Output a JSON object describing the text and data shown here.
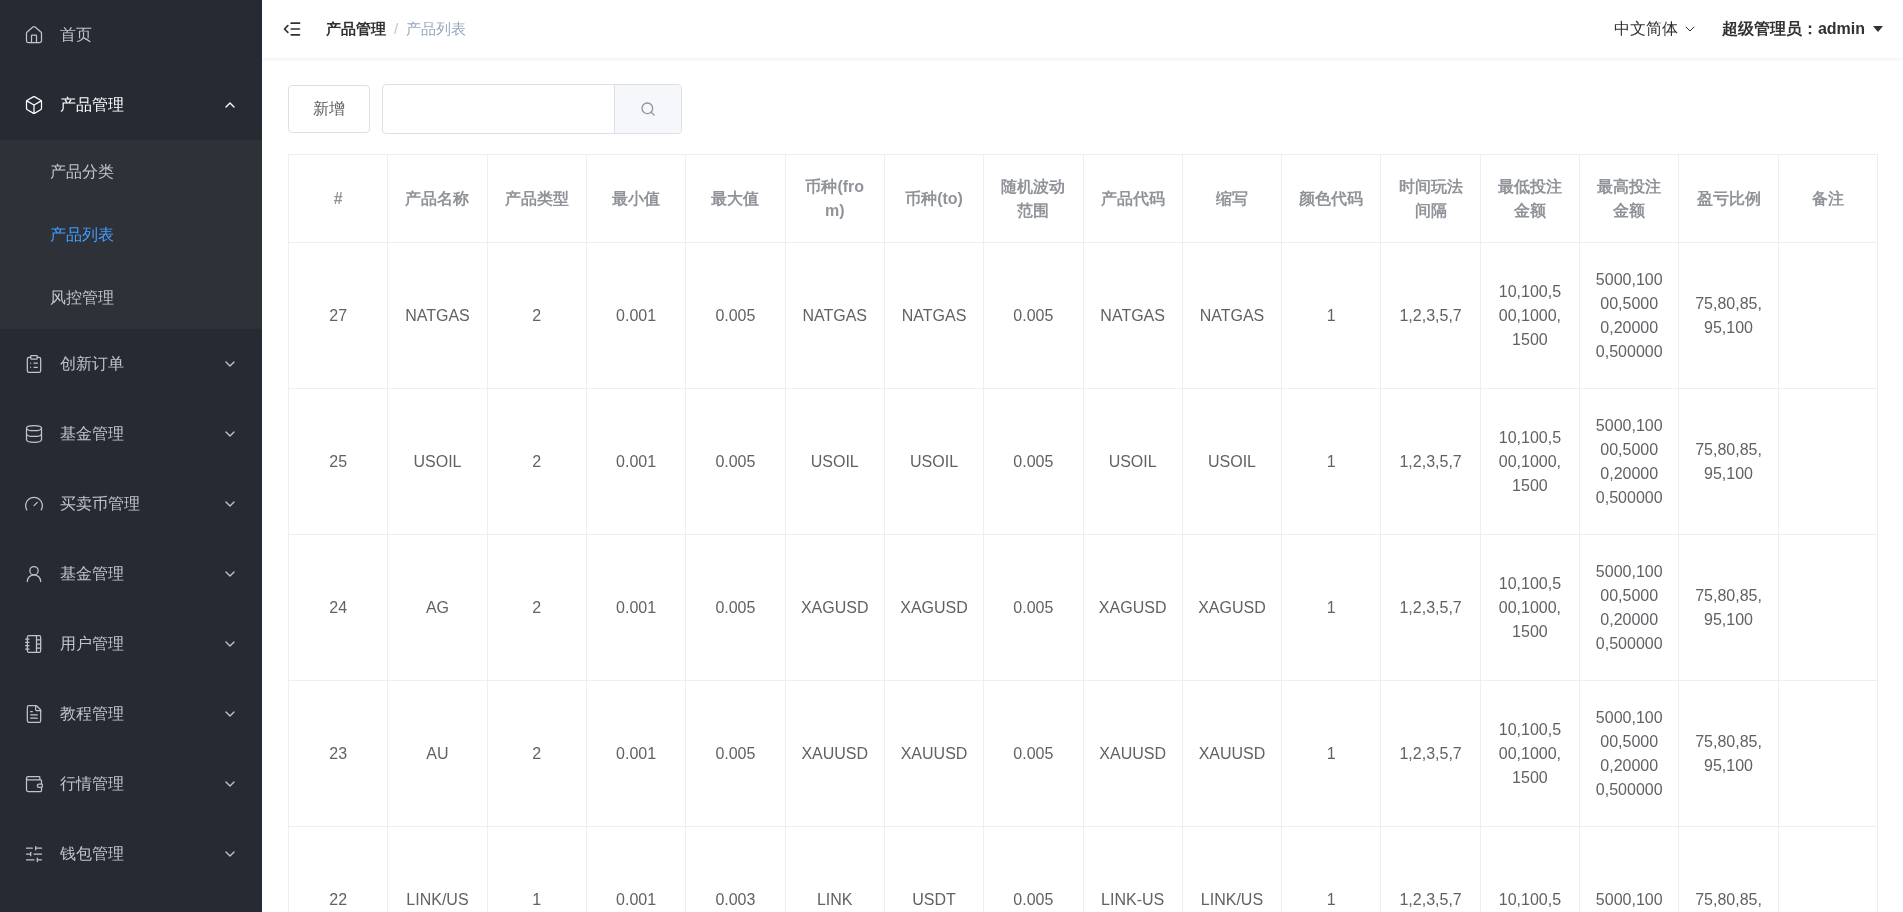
{
  "sidebar": {
    "items": [
      {
        "kind": "link",
        "label": "首页"
      },
      {
        "kind": "menu",
        "label": "产品管理",
        "expanded": true,
        "children": [
          {
            "label": "产品分类",
            "selected": false
          },
          {
            "label": "产品列表",
            "selected": true
          },
          {
            "label": "风控管理",
            "selected": false
          }
        ]
      },
      {
        "kind": "menu",
        "label": "创新订单",
        "expanded": false
      },
      {
        "kind": "menu",
        "label": "基金管理",
        "expanded": false
      },
      {
        "kind": "menu",
        "label": "买卖币管理",
        "expanded": false
      },
      {
        "kind": "menu",
        "label": "基金管理",
        "expanded": false
      },
      {
        "kind": "menu",
        "label": "用户管理",
        "expanded": false
      },
      {
        "kind": "menu",
        "label": "教程管理",
        "expanded": false
      },
      {
        "kind": "menu",
        "label": "行情管理",
        "expanded": false
      },
      {
        "kind": "menu",
        "label": "钱包管理",
        "expanded": false
      }
    ]
  },
  "header": {
    "breadcrumb": [
      "产品管理",
      "产品列表"
    ],
    "separator": "/",
    "language": "中文简体",
    "user": "超级管理员：admin"
  },
  "toolbar": {
    "add_button": "新增"
  },
  "table": {
    "columns": [
      "#",
      "产品名称",
      "产品类型",
      "最小值",
      "最大值",
      "币种(from)",
      "币种(to)",
      "随机波动范围",
      "产品代码",
      "缩写",
      "颜色代码",
      "时间玩法间隔",
      "最低投注金额",
      "最高投注金额",
      "盈亏比例",
      "备注"
    ],
    "rows": [
      [
        "27",
        "NATGAS",
        "2",
        "0.001",
        "0.005",
        "NATGAS",
        "NATGAS",
        "0.005",
        "NATGAS",
        "NATGAS",
        "1",
        "1,2,3,5,7",
        "10,100,500,1000,1500",
        "5000,10000,50000,200000,500000",
        "75,80,85,95,100",
        ""
      ],
      [
        "25",
        "USOIL",
        "2",
        "0.001",
        "0.005",
        "USOIL",
        "USOIL",
        "0.005",
        "USOIL",
        "USOIL",
        "1",
        "1,2,3,5,7",
        "10,100,500,1000,1500",
        "5000,10000,50000,200000,500000",
        "75,80,85,95,100",
        ""
      ],
      [
        "24",
        "AG",
        "2",
        "0.001",
        "0.005",
        "XAGUSD",
        "XAGUSD",
        "0.005",
        "XAGUSD",
        "XAGUSD",
        "1",
        "1,2,3,5,7",
        "10,100,500,1000,1500",
        "5000,10000,50000,200000,500000",
        "75,80,85,95,100",
        ""
      ],
      [
        "23",
        "AU",
        "2",
        "0.001",
        "0.005",
        "XAUUSD",
        "XAUUSD",
        "0.005",
        "XAUUSD",
        "XAUUSD",
        "1",
        "1,2,3,5,7",
        "10,100,500,1000,1500",
        "5000,10000,50000,200000,500000",
        "75,80,85,95,100",
        ""
      ],
      [
        "22",
        "LINK/US",
        "1",
        "0.001",
        "0.003",
        "LINK",
        "USDT",
        "0.005",
        "LINK-US",
        "LINK/US",
        "1",
        "1,2,3,5,7",
        "10,100,5",
        "5000,100",
        "75,80,85,",
        ""
      ]
    ]
  }
}
